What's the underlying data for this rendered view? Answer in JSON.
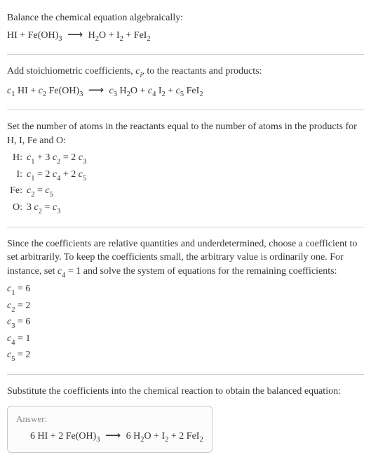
{
  "chart_data": {
    "type": "table",
    "reaction_unbalanced": "HI + Fe(OH)3 -> H2O + I2 + FeI2",
    "reaction_with_coeffs": "c1 HI + c2 Fe(OH)3 -> c3 H2O + c4 I2 + c5 FeI2",
    "atom_balance": {
      "H": "c1 + 3 c2 = 2 c3",
      "I": "c1 = 2 c4 + 2 c5",
      "Fe": "c2 = c5",
      "O": "3 c2 = c3"
    },
    "solved_coefficients": {
      "c1": 6,
      "c2": 2,
      "c3": 6,
      "c4": 1,
      "c5": 2
    },
    "balanced_equation": "6 HI + 2 Fe(OH)3 -> 6 H2O + I2 + 2 FeI2"
  },
  "s1": {
    "line1": "Balance the chemical equation algebraically:",
    "eq_hi": "HI",
    "plus": " + ",
    "eq_feoh": "Fe(OH)",
    "three": "3",
    "arrow": "⟶",
    "eq_h2o_h": "H",
    "two": "2",
    "eq_h2o_o": "O",
    "eq_i": "I",
    "eq_fei": "FeI"
  },
  "s2": {
    "line1a": "Add stoichiometric coefficients, ",
    "ci": "c",
    "i": "i",
    "line1b": ", to the reactants and products:",
    "c1": "c",
    "n1": "1",
    "c2": "c",
    "n2": "2",
    "c3": "c",
    "n3": "3",
    "c4": "c",
    "n4": "4",
    "c5": "c",
    "n5": "5",
    "sp": " "
  },
  "s3": {
    "line1": "Set the number of atoms in the reactants equal to the number of atoms in the products for H, I, Fe and O:",
    "H_label": "H:",
    "H_eq_a": "c",
    "H_1": "1",
    "H_eq_b": " + 3",
    "H_eq_c": "c",
    "H_2": "2",
    "H_eq_d": " = 2",
    "H_eq_e": "c",
    "H_3": "3",
    "I_label": "I:",
    "I_eq_a": "c",
    "I_1": "1",
    "I_eq_b": " = 2",
    "I_eq_c": "c",
    "I_4": "4",
    "I_eq_d": " + 2",
    "I_eq_e": "c",
    "I_5": "5",
    "Fe_label": "Fe:",
    "Fe_eq_a": "c",
    "Fe_2": "2",
    "Fe_eq_b": " = ",
    "Fe_eq_c": "c",
    "Fe_5": "5",
    "O_label": "O:",
    "O_eq_a": "3",
    "O_eq_b": "c",
    "O_2": "2",
    "O_eq_c": " = ",
    "O_eq_d": "c",
    "O_3": "3"
  },
  "s4": {
    "line1": "Since the coefficients are relative quantities and underdetermined, choose a coefficient to set arbitrarily. To keep the coefficients small, the arbitrary value is ordinarily one. For instance, set ",
    "c4": "c",
    "n4": "4",
    "eq1": " = 1",
    "line1b": " and solve the system of equations for the remaining coefficients:",
    "r1a": "c",
    "r1n": "1",
    "r1b": " = 6",
    "r2a": "c",
    "r2n": "2",
    "r2b": " = 2",
    "r3a": "c",
    "r3n": "3",
    "r3b": " = 6",
    "r4a": "c",
    "r4n": "4",
    "r4b": " = 1",
    "r5a": "c",
    "r5n": "5",
    "r5b": " = 2"
  },
  "s5": {
    "line1": "Substitute the coefficients into the chemical reaction to obtain the balanced equation:",
    "answer_label": "Answer:",
    "six": "6 ",
    "two_sp": "2 ",
    "hi": "HI",
    "plus": " + ",
    "feoh": "Fe(OH)",
    "three": "3",
    "arrow": "⟶",
    "h": "H",
    "twosub": "2",
    "o": "O",
    "i": "I",
    "fei": "FeI"
  }
}
